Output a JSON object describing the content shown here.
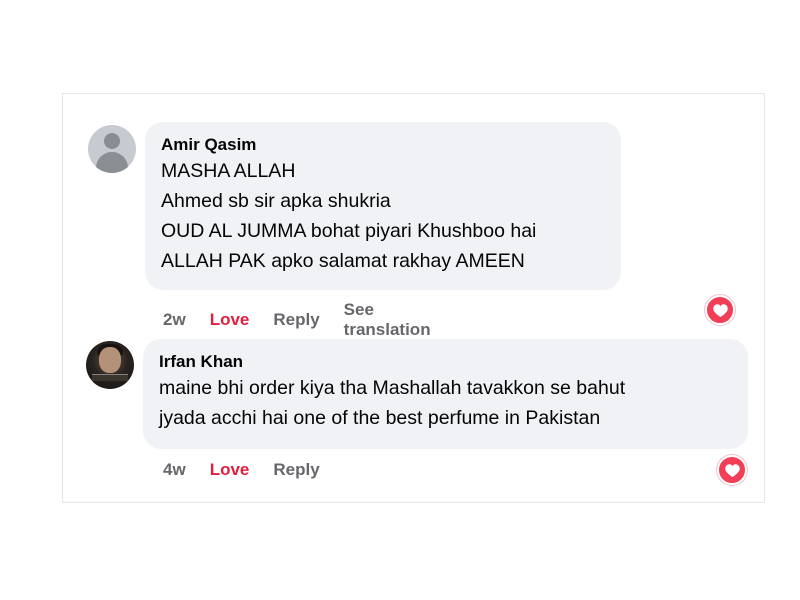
{
  "comments": [
    {
      "author": "Amir Qasim",
      "lines": [
        "MASHA ALLAH",
        "Ahmed sb sir apka shukria",
        "OUD AL JUMMA bohat piyari Khushboo hai",
        "ALLAH PAK apko salamat rakhay AMEEN"
      ],
      "time": "2w",
      "love_label": "Love",
      "reply_label": "Reply",
      "translation_label": "See translation",
      "reaction_icon": "heart-icon",
      "avatar_icon": "default-avatar-icon"
    },
    {
      "author": "Irfan Khan",
      "lines": [
        "maine bhi order kiya tha Mashallah tavakkon se bahut",
        "jyada acchi hai one of the best perfume in Pakistan"
      ],
      "time": "4w",
      "love_label": "Love",
      "reply_label": "Reply",
      "reaction_icon": "heart-icon",
      "avatar_icon": "profile-photo"
    }
  ],
  "colors": {
    "bubble_bg": "#f0f2f5",
    "love": "#e41e3f",
    "meta_text": "#65676b",
    "heart_badge": "#f33e58"
  }
}
